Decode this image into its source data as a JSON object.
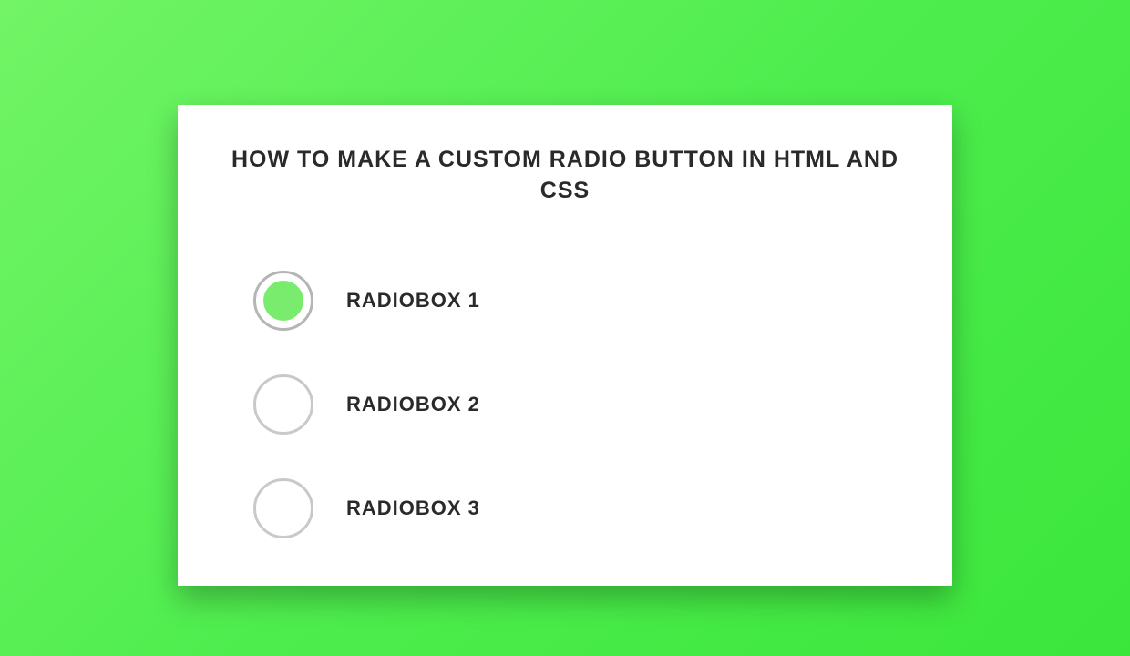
{
  "card": {
    "title": "How to make a custom radio button in html and css"
  },
  "options": [
    {
      "label": "Radiobox 1",
      "checked": true
    },
    {
      "label": "Radiobox 2",
      "checked": false
    },
    {
      "label": "Radiobox 3",
      "checked": false
    }
  ],
  "colors": {
    "accent": "#79ec6e",
    "background_start": "#72f466",
    "background_end": "#3be63b",
    "text": "#2a2a2a",
    "radio_border": "#c9c9c9"
  }
}
